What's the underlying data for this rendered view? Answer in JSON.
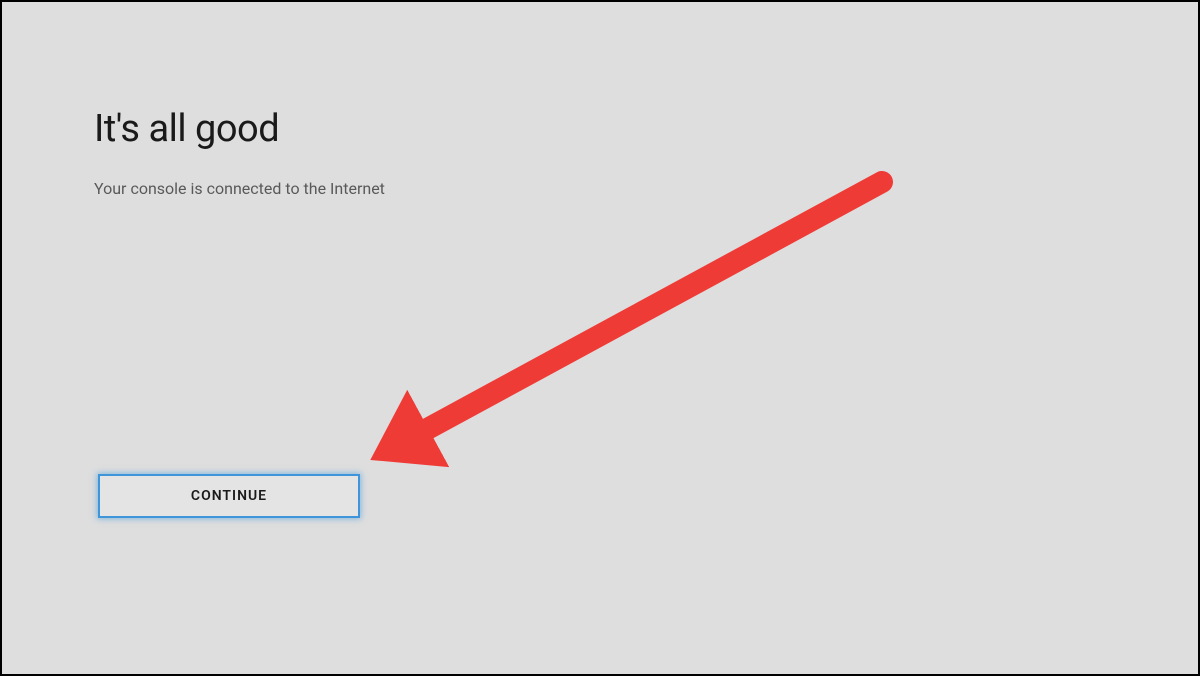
{
  "page": {
    "title": "It's all good",
    "subtitle": "Your console is connected to the Internet"
  },
  "actions": {
    "continue_label": "CONTINUE"
  },
  "annotation": {
    "arrow_color": "#ef3b36"
  }
}
